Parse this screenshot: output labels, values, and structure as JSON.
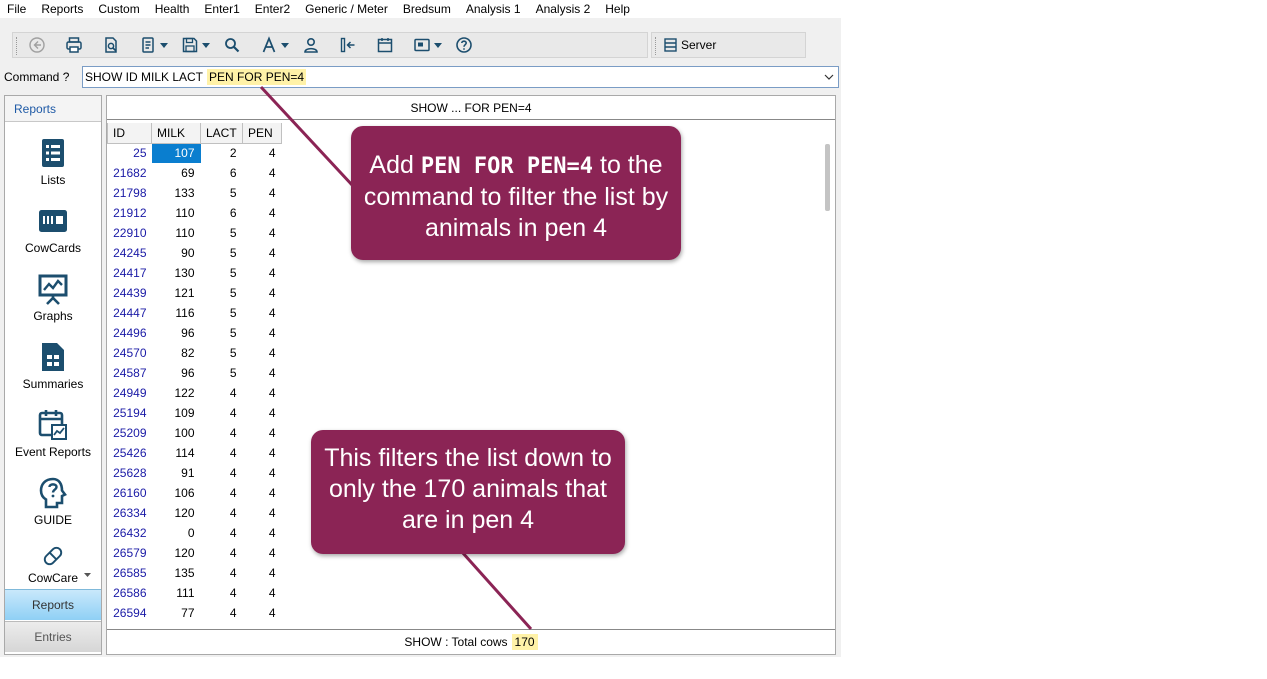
{
  "menu": [
    "File",
    "Reports",
    "Custom",
    "Health",
    "Enter1",
    "Enter2",
    "Generic / Meter",
    "Bredsum",
    "Analysis 1",
    "Analysis 2",
    "Help"
  ],
  "toolbar": {
    "server_label": "Server",
    "icons": [
      "back-icon",
      "print-icon",
      "print-preview-icon",
      "report-icon",
      "save-icon",
      "search-icon",
      "font-icon",
      "user-icon",
      "column-icon",
      "calendar-icon",
      "card-icon",
      "help-icon"
    ]
  },
  "command": {
    "label": "Command ?",
    "value": "SHOW ID MILK LACT",
    "highlight": "PEN FOR PEN=4"
  },
  "nav": {
    "header": "Reports",
    "items": [
      {
        "label": "Lists",
        "icon": "list-icon"
      },
      {
        "label": "CowCards",
        "icon": "cowcard-icon"
      },
      {
        "label": "Graphs",
        "icon": "graph-icon"
      },
      {
        "label": "Summaries",
        "icon": "summary-icon"
      },
      {
        "label": "Event Reports",
        "icon": "event-report-icon"
      },
      {
        "label": "GUIDE",
        "icon": "guide-icon"
      },
      {
        "label": "CowCare",
        "icon": "pill-icon"
      }
    ],
    "tabs": {
      "active": "Reports",
      "inactive": "Entries"
    }
  },
  "report": {
    "title": "SHOW ...  FOR PEN=4",
    "columns": [
      "ID",
      "MILK",
      "LACT",
      "PEN"
    ],
    "rows": [
      [
        "25",
        "107",
        "2",
        "4"
      ],
      [
        "21682",
        "69",
        "6",
        "4"
      ],
      [
        "21798",
        "133",
        "5",
        "4"
      ],
      [
        "21912",
        "110",
        "6",
        "4"
      ],
      [
        "22910",
        "110",
        "5",
        "4"
      ],
      [
        "24245",
        "90",
        "5",
        "4"
      ],
      [
        "24417",
        "130",
        "5",
        "4"
      ],
      [
        "24439",
        "121",
        "5",
        "4"
      ],
      [
        "24447",
        "116",
        "5",
        "4"
      ],
      [
        "24496",
        "96",
        "5",
        "4"
      ],
      [
        "24570",
        "82",
        "5",
        "4"
      ],
      [
        "24587",
        "96",
        "5",
        "4"
      ],
      [
        "24949",
        "122",
        "4",
        "4"
      ],
      [
        "25194",
        "109",
        "4",
        "4"
      ],
      [
        "25209",
        "100",
        "4",
        "4"
      ],
      [
        "25426",
        "114",
        "4",
        "4"
      ],
      [
        "25628",
        "91",
        "4",
        "4"
      ],
      [
        "26160",
        "106",
        "4",
        "4"
      ],
      [
        "26334",
        "120",
        "4",
        "4"
      ],
      [
        "26432",
        "0",
        "4",
        "4"
      ],
      [
        "26579",
        "120",
        "4",
        "4"
      ],
      [
        "26585",
        "135",
        "4",
        "4"
      ],
      [
        "26586",
        "111",
        "4",
        "4"
      ],
      [
        "26594",
        "77",
        "4",
        "4"
      ]
    ],
    "footer_label": "SHOW : Total cows",
    "footer_count": "170"
  },
  "callouts": {
    "first_pre": "Add",
    "first_code": "PEN FOR PEN=4",
    "first_post": "to the command to filter the list by animals in pen 4",
    "second": "This filters the list down to only the 170 animals that are in pen 4"
  },
  "colors": {
    "callout": "#8b2455",
    "highlight": "#fff2a8",
    "selection": "#0a7ecf",
    "icon": "#1c4e6e"
  }
}
